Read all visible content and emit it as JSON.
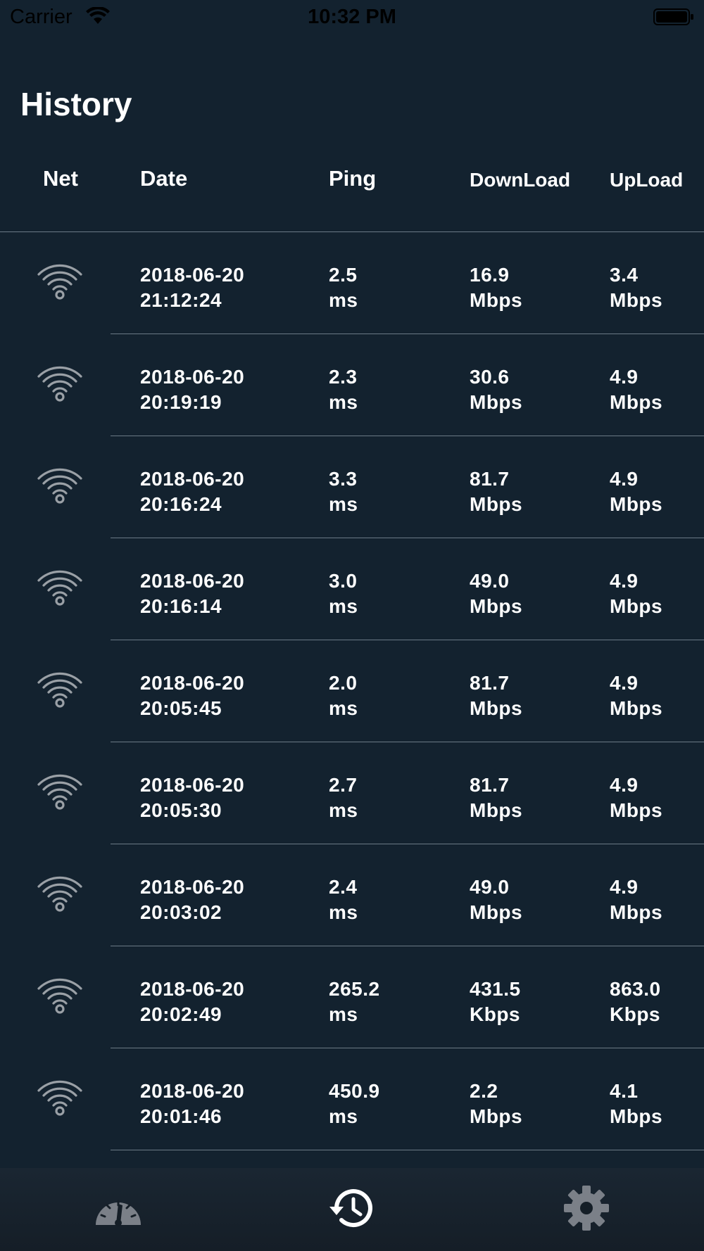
{
  "status_bar": {
    "carrier": "Carrier",
    "time": "10:32 PM",
    "icons": [
      "wifi-signal-icon",
      "battery-icon"
    ]
  },
  "title": "History",
  "columns": {
    "net": "Net",
    "date": "Date",
    "ping": "Ping",
    "download": "DownLoad",
    "upload": "UpLoad"
  },
  "rows": [
    {
      "net_icon": "wifi-icon",
      "date": "2018-06-20",
      "time": "21:12:24",
      "ping": "2.5",
      "ping_unit": "ms",
      "download": "16.9",
      "download_unit": "Mbps",
      "upload": "3.4",
      "upload_unit": "Mbps"
    },
    {
      "net_icon": "wifi-icon",
      "date": "2018-06-20",
      "time": "20:19:19",
      "ping": "2.3",
      "ping_unit": "ms",
      "download": "30.6",
      "download_unit": "Mbps",
      "upload": "4.9",
      "upload_unit": "Mbps"
    },
    {
      "net_icon": "wifi-icon",
      "date": "2018-06-20",
      "time": "20:16:24",
      "ping": "3.3",
      "ping_unit": "ms",
      "download": "81.7",
      "download_unit": "Mbps",
      "upload": "4.9",
      "upload_unit": "Mbps"
    },
    {
      "net_icon": "wifi-icon",
      "date": "2018-06-20",
      "time": "20:16:14",
      "ping": "3.0",
      "ping_unit": "ms",
      "download": "49.0",
      "download_unit": "Mbps",
      "upload": "4.9",
      "upload_unit": "Mbps"
    },
    {
      "net_icon": "wifi-icon",
      "date": "2018-06-20",
      "time": "20:05:45",
      "ping": "2.0",
      "ping_unit": "ms",
      "download": "81.7",
      "download_unit": "Mbps",
      "upload": "4.9",
      "upload_unit": "Mbps"
    },
    {
      "net_icon": "wifi-icon",
      "date": "2018-06-20",
      "time": "20:05:30",
      "ping": "2.7",
      "ping_unit": "ms",
      "download": "81.7",
      "download_unit": "Mbps",
      "upload": "4.9",
      "upload_unit": "Mbps"
    },
    {
      "net_icon": "wifi-icon",
      "date": "2018-06-20",
      "time": "20:03:02",
      "ping": "2.4",
      "ping_unit": "ms",
      "download": "49.0",
      "download_unit": "Mbps",
      "upload": "4.9",
      "upload_unit": "Mbps"
    },
    {
      "net_icon": "wifi-icon",
      "date": "2018-06-20",
      "time": "20:02:49",
      "ping": "265.2",
      "ping_unit": "ms",
      "download": "431.5",
      "download_unit": "Kbps",
      "upload": "863.0",
      "upload_unit": "Kbps"
    },
    {
      "net_icon": "wifi-icon",
      "date": "2018-06-20",
      "time": "20:01:46",
      "ping": "450.9",
      "ping_unit": "ms",
      "download": "2.2",
      "download_unit": "Mbps",
      "upload": "4.1",
      "upload_unit": "Mbps"
    }
  ],
  "tab_bar": {
    "tabs": [
      {
        "icon": "speedometer-icon",
        "selected": false
      },
      {
        "icon": "history-icon",
        "selected": true
      },
      {
        "icon": "gear-icon",
        "selected": false
      }
    ]
  },
  "colors": {
    "background": "#13222f",
    "text": "#ffffff",
    "divider": "#6b7a86",
    "icon_gray": "#9aa0a6",
    "tab_inactive": "#7b8088",
    "tab_active": "#ffffff"
  }
}
